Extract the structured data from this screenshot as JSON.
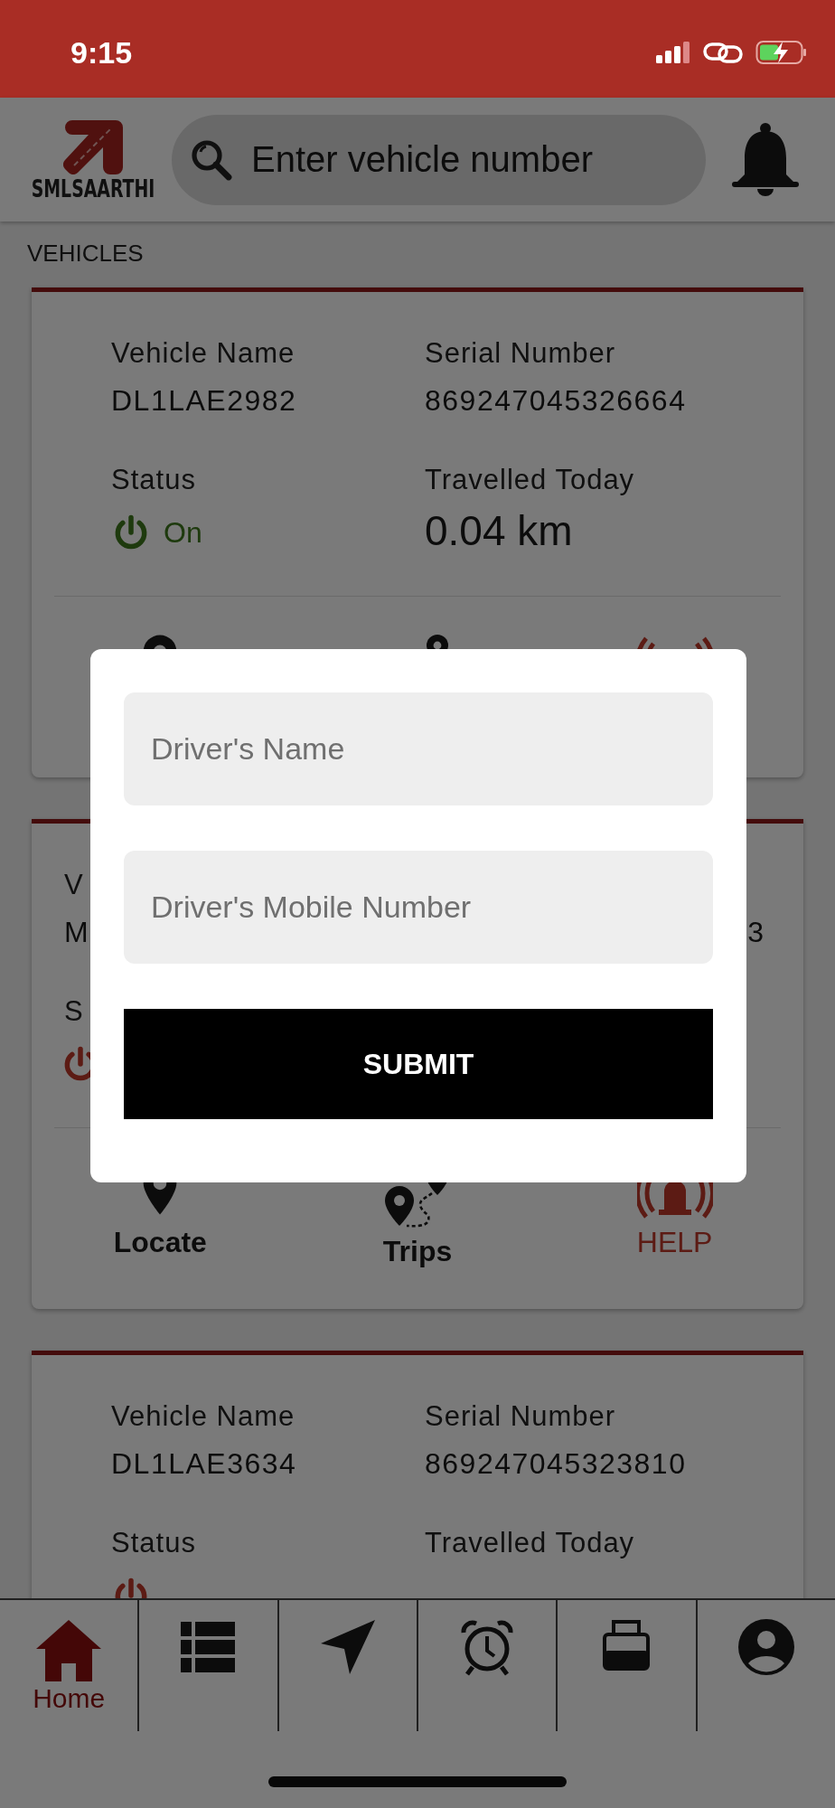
{
  "status_bar": {
    "time": "9:15"
  },
  "header": {
    "logo_text": "SMLSAARTHI",
    "search": {
      "placeholder": "Enter vehicle number"
    }
  },
  "section_title": "VEHICLES",
  "vehicles": [
    {
      "kind": "full",
      "vehicle_name_label": "Vehicle Name",
      "vehicle_name": "DL1LAE2982",
      "serial_label": "Serial Number",
      "serial_number": "869247045326664",
      "status_label": "Status",
      "on": true,
      "status_text": "On",
      "travelled_label": "Travelled Today",
      "travelled": "0.04 km",
      "actions": [
        {
          "kind": "locate"
        },
        {
          "kind": "trips"
        },
        {
          "kind": "help"
        }
      ]
    },
    {
      "kind": "covered",
      "vehicle_name_label": "V",
      "vehicle_name": "M",
      "serial_number": "3",
      "status_label": "S",
      "on": false,
      "actions": [
        {
          "kind": "locate",
          "label": "Locate"
        },
        {
          "kind": "trips",
          "label": "Trips"
        },
        {
          "kind": "help",
          "label": "HELP"
        }
      ]
    },
    {
      "kind": "full",
      "vehicle_name_label": "Vehicle Name",
      "vehicle_name": "DL1LAE3634",
      "serial_label": "Serial Number",
      "serial_number": "869247045323810",
      "status_label": "Status",
      "on": false,
      "travelled_label": "Travelled Today"
    }
  ],
  "tab_bar": [
    {
      "kind": "home",
      "label": "Home",
      "selected": true
    },
    {
      "kind": "list",
      "selected": false
    },
    {
      "kind": "navigate",
      "selected": false
    },
    {
      "kind": "alarm",
      "selected": false
    },
    {
      "kind": "device",
      "selected": false
    },
    {
      "kind": "profile",
      "selected": false
    }
  ],
  "modal": {
    "fields": [
      {
        "placeholder": "Driver's Name"
      },
      {
        "placeholder": "Driver's Mobile Number"
      }
    ],
    "submit": "SUBMIT"
  }
}
